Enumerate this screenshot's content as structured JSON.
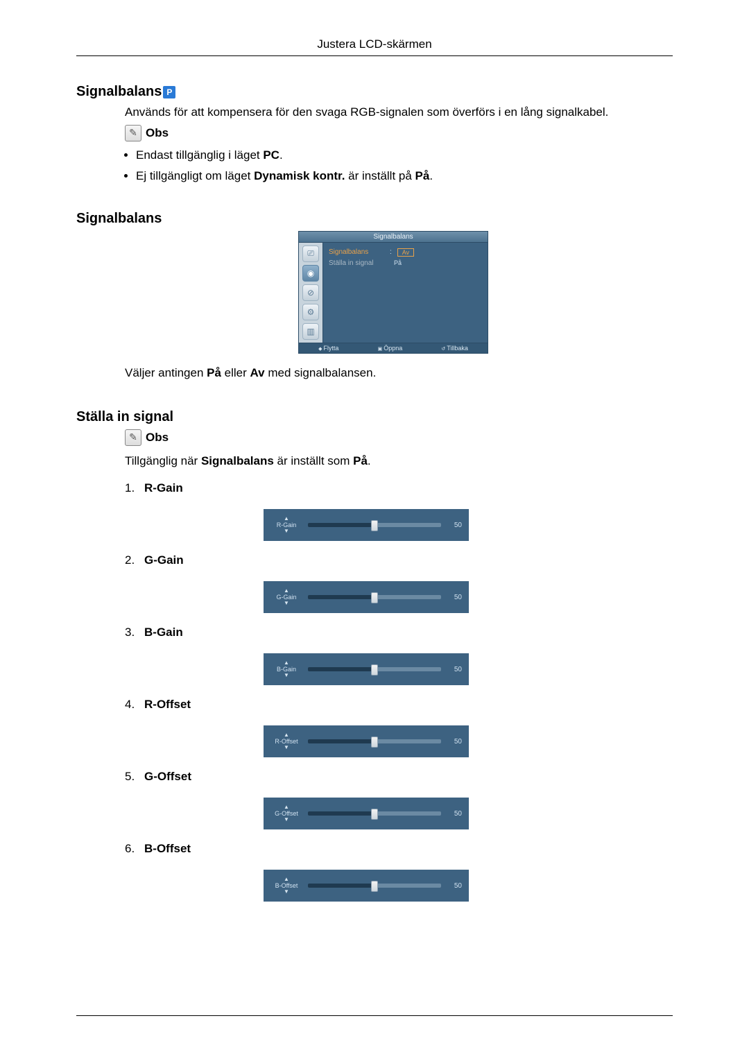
{
  "header": "Justera LCD-skärmen",
  "section1": {
    "title": "Signalbalans",
    "pc_badge": "P",
    "intro": "Används för att kompensera för den svaga RGB-signalen som överförs i en lång signalkabel.",
    "obs_label": "Obs",
    "bullets": {
      "b1_pre": "Endast tillgänglig i läget ",
      "b1_bold": "PC",
      "b1_post": ".",
      "b2_pre": "Ej tillgängligt om läget ",
      "b2_bold": "Dynamisk kontr.",
      "b2_mid": " är inställt på ",
      "b2_bold2": "På",
      "b2_post": "."
    }
  },
  "section2": {
    "title": "Signalbalans",
    "osd": {
      "title": "Signalbalans",
      "row1_label": "Signalbalans",
      "row1_sel": "Av",
      "row2_label": "Ställa in signal",
      "row2_val": "På",
      "footer_move": "Flytta",
      "footer_open": "Öppna",
      "footer_back": "Tillbaka"
    },
    "desc_pre": "Väljer antingen ",
    "desc_b1": "På",
    "desc_mid": " eller ",
    "desc_b2": "Av",
    "desc_post": " med signalbalansen."
  },
  "section3": {
    "title": "Ställa in signal",
    "obs_label": "Obs",
    "avail_pre": "Tillgänglig när ",
    "avail_bold": "Signalbalans",
    "avail_mid": " är inställt som ",
    "avail_bold2": "På",
    "avail_post": ".",
    "params": [
      {
        "num": "1.",
        "label": "R-Gain",
        "slider_label": "R-Gain",
        "value": "50"
      },
      {
        "num": "2.",
        "label": "G-Gain",
        "slider_label": "G-Gain",
        "value": "50"
      },
      {
        "num": "3.",
        "label": "B-Gain",
        "slider_label": "B-Gain",
        "value": "50"
      },
      {
        "num": "4.",
        "label": "R-Offset",
        "slider_label": "R-Offset",
        "value": "50"
      },
      {
        "num": "5.",
        "label": "G-Offset",
        "slider_label": "G-Offset",
        "value": "50"
      },
      {
        "num": "6.",
        "label": "B-Offset",
        "slider_label": "B-Offset",
        "value": "50"
      }
    ]
  }
}
